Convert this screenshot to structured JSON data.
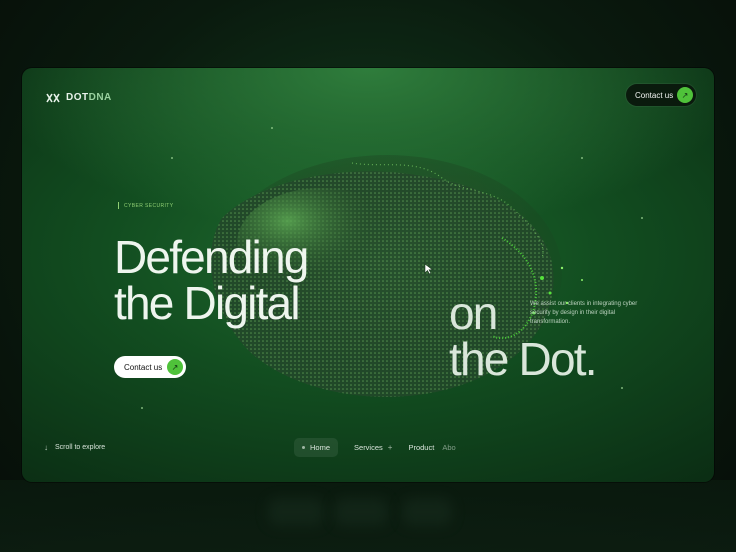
{
  "brand": {
    "name_a": "DOT",
    "name_b": "DNA",
    "logo_icon": "dna-logo-icon"
  },
  "header": {
    "contact_label": "Contact us",
    "contact_icon": "arrow-up-right-icon"
  },
  "hero": {
    "tag": "CYBER SECURITY",
    "headline_line1": "Defending",
    "headline_line2": "the Digital",
    "headline_line3": "on",
    "headline_line4": "the Dot.",
    "cta_label": "Contact us",
    "cta_icon": "arrow-up-right-icon",
    "description": "We assist our clients in integrating cyber security by design in their digital transformation."
  },
  "footer": {
    "scroll_label": "Scroll to explore",
    "scroll_icon": "arrow-down-icon",
    "nav_items": [
      "Home",
      "Services",
      "Product",
      "Abo"
    ]
  },
  "colors": {
    "accent": "#4fc23a",
    "tag_green": "#8fcf73",
    "background": "#124d20",
    "text": "#eef5ee"
  }
}
